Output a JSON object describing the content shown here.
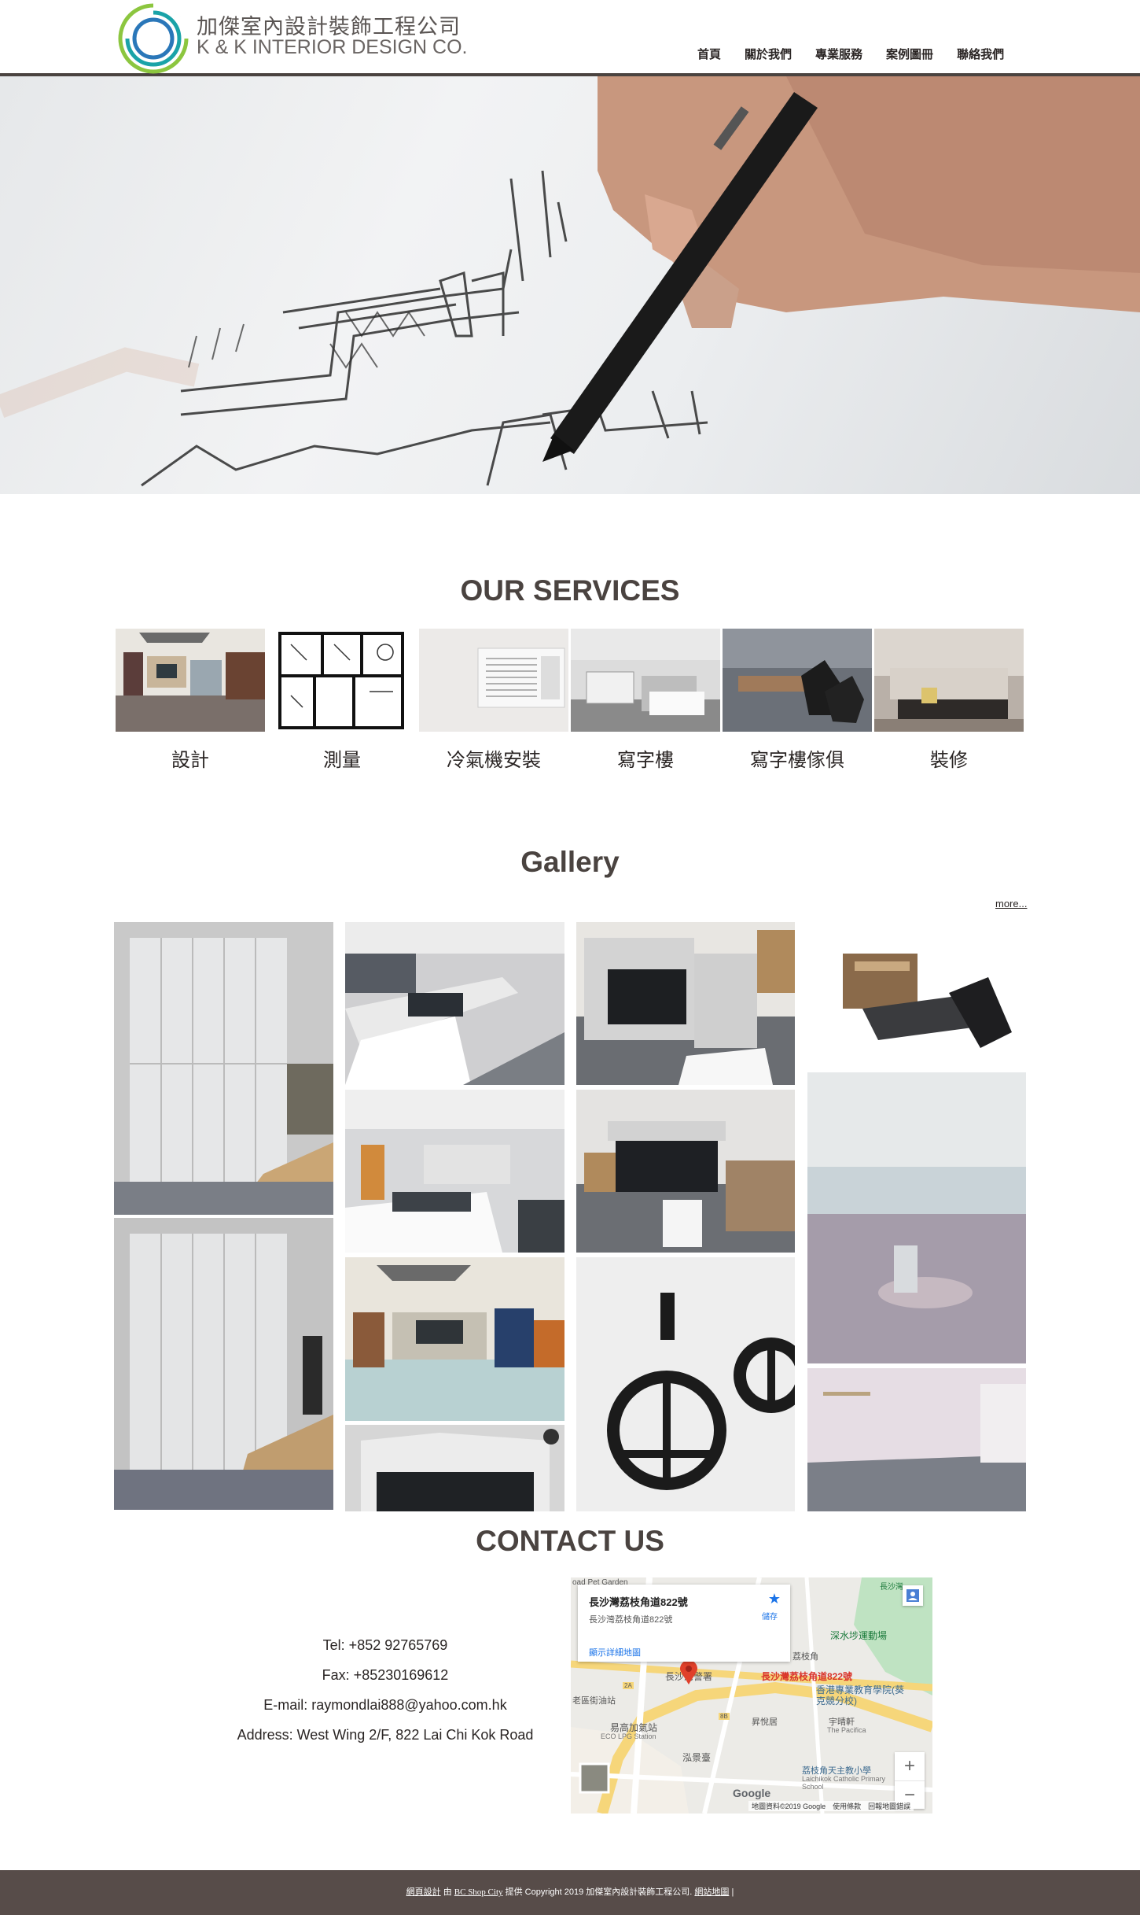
{
  "brand": {
    "name_cn": "加傑室內設計裝飾工程公司",
    "name_en": "K & K INTERIOR DESIGN CO.",
    "colors": {
      "ring_green": "#8cc63f",
      "ring_teal": "#1aa3a8",
      "ring_blue": "#2a77b9",
      "nav_text": "#2a2524",
      "title": "#4a4340",
      "footer_bg": "#574c49"
    }
  },
  "nav": {
    "items": [
      {
        "label": "首頁"
      },
      {
        "label": "關於我們"
      },
      {
        "label": "專業服務"
      },
      {
        "label": "案例圖冊"
      },
      {
        "label": "聯絡我們"
      }
    ]
  },
  "services": {
    "title": "OUR SERVICES",
    "items": [
      {
        "label": "設計"
      },
      {
        "label": "測量"
      },
      {
        "label": "冷氣機安裝"
      },
      {
        "label": "寫字樓"
      },
      {
        "label": "寫字樓傢俱"
      },
      {
        "label": "裝修"
      }
    ]
  },
  "gallery": {
    "title": "Gallery",
    "more": "more..."
  },
  "contact": {
    "title": "CONTACT US",
    "tel": "Tel: +852 92765769",
    "fax": "Fax: +85230169612",
    "email": "E-mail: raymondlai888@yahoo.com.hk",
    "address": "Address: West Wing 2/F, 822 Lai Chi Kok Road"
  },
  "map": {
    "card_title": "長沙灣荔枝角道822號",
    "card_subtitle": "長沙灣荔枝角道822號",
    "save_label": "儲存",
    "details_link": "顯示詳細地圖",
    "pin_label": "長沙灣荔枝角道822號",
    "labels": {
      "pet_garden": "oad Pet Garden",
      "cheung_sha_wan": "長沙灣",
      "sports_ground": "深水埗運動場",
      "police": "長沙灣警署",
      "lai_chi_kok": "荔枝角",
      "fuel_station": "老區街油站",
      "eco_station": "易高加氣站",
      "eco_station_en": "ECO LPG Station",
      "school": "香港專業教育學院(葵克競分校)",
      "liberte": "昇悅居",
      "pacifica": "宇晴軒",
      "pacifica_en": "The Pacifica",
      "hall": "泓景臺",
      "catholic_school": "荔枝角天主教小學",
      "catholic_school_en": "Laichikok Catholic Primary School",
      "google": "Google",
      "attribution": "地圖資料©2019 Google　使用條款　回報地圖錯誤",
      "road_2a": "2A",
      "road_8b": "8B"
    },
    "zoom_in": "+",
    "zoom_out": "−"
  },
  "footer": {
    "link_design": "網頁設計",
    "text_by": "由",
    "link_bcshop": "BC Shop City",
    "text_rest": "提供 Copyright 2019 加傑室內設計裝飾工程公司.",
    "link_sitemap": "網站地圖",
    "sep": "|"
  }
}
